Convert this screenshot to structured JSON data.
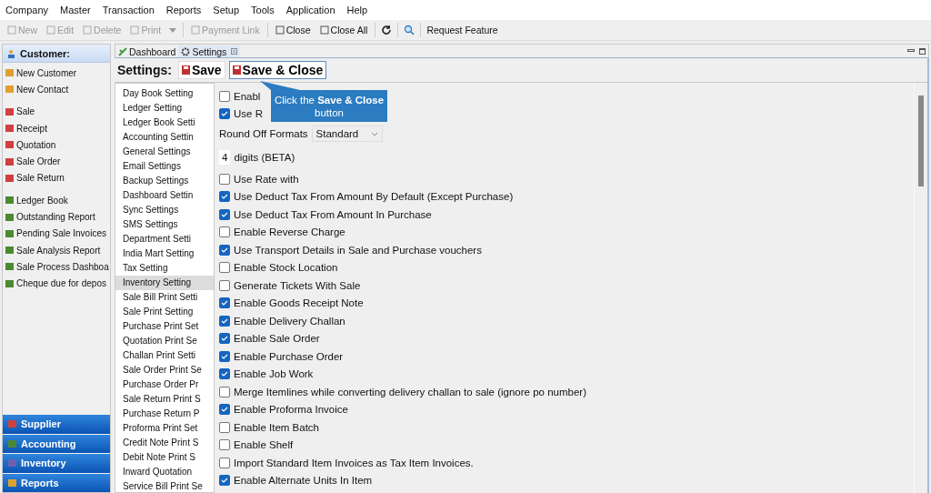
{
  "menu_bar": [
    "Company",
    "Master",
    "Transaction",
    "Reports",
    "Setup",
    "Tools",
    "Application",
    "Help"
  ],
  "toolbar": [
    {
      "label": "New",
      "kind": "button",
      "disabled": true
    },
    {
      "label": "Edit",
      "kind": "button",
      "disabled": true
    },
    {
      "label": "Delete",
      "kind": "button",
      "disabled": true
    },
    {
      "label": "Print",
      "kind": "button",
      "disabled": true
    },
    {
      "kind": "caret",
      "disabled": true
    },
    {
      "label": "Payment Link",
      "kind": "button",
      "disabled": true
    },
    {
      "label": "Close",
      "kind": "button",
      "disabled": false
    },
    {
      "label": "Close All",
      "kind": "button",
      "disabled": false
    },
    {
      "kind": "refresh",
      "disabled": false
    },
    {
      "kind": "search",
      "disabled": false
    },
    {
      "label": "Request Feature",
      "kind": "text",
      "disabled": false
    }
  ],
  "sidebar": {
    "header": "Customer:",
    "groups": [
      [
        "New Customer",
        "New Contact"
      ],
      [
        "Sale",
        "Receipt",
        "Quotation",
        "Sale Order",
        "Sale Return"
      ],
      [
        "Ledger Book",
        "Outstanding Report",
        "Pending Sale Invoices",
        "Sale Analysis Report",
        "Sale Process Dashboa",
        "Cheque due for depos"
      ]
    ],
    "sections": [
      "Supplier",
      "Accounting",
      "Inventory",
      "Reports"
    ]
  },
  "tabs": [
    {
      "label": "Dashboard",
      "selected": false
    },
    {
      "label": "Settings",
      "selected": true
    }
  ],
  "settings": {
    "title": "Settings:",
    "buttons": [
      "Save",
      "Save & Close"
    ],
    "categories": [
      {
        "label": "Day Book Setting",
        "selected": false
      },
      {
        "label": "Ledger Setting",
        "selected": false
      },
      {
        "label": "Ledger Book Setti",
        "selected": false
      },
      {
        "label": "Accounting Settin",
        "selected": false
      },
      {
        "label": "General Settings",
        "selected": false
      },
      {
        "label": "Email Settings",
        "selected": false
      },
      {
        "label": "Backup Settings",
        "selected": false
      },
      {
        "label": "Dashboard Settin",
        "selected": false
      },
      {
        "label": "Sync Settings",
        "selected": false
      },
      {
        "label": "SMS Settings",
        "selected": false
      },
      {
        "label": "Department Setti",
        "selected": false
      },
      {
        "label": "India Mart Setting",
        "selected": false
      },
      {
        "label": "Tax Setting",
        "selected": false
      },
      {
        "label": "Inventory Setting",
        "selected": true
      },
      {
        "label": "Sale Bill Print Setti",
        "selected": false
      },
      {
        "label": "Sale Print Setting",
        "selected": false
      },
      {
        "label": "Purchase Print Set",
        "selected": false
      },
      {
        "label": "Quotation Print Se",
        "selected": false
      },
      {
        "label": "Challan Print Setti",
        "selected": false
      },
      {
        "label": "Sale Order Print Se",
        "selected": false
      },
      {
        "label": "Purchase Order Pr",
        "selected": false
      },
      {
        "label": "Sale Return Print S",
        "selected": false
      },
      {
        "label": "Purchase Return P",
        "selected": false
      },
      {
        "label": "Proforma Print Set",
        "selected": false
      },
      {
        "label": "Credit Note Print S",
        "selected": false
      },
      {
        "label": "Debit Note Print S",
        "selected": false
      },
      {
        "label": "Inward Quotation",
        "selected": false
      },
      {
        "label": "Service Bill Print Se",
        "selected": false
      }
    ],
    "options": [
      {
        "kind": "checkbox",
        "label": "Enabl",
        "checked": false
      },
      {
        "kind": "checkbox",
        "label": "Use R",
        "checked": true
      },
      {
        "kind": "select",
        "label": "Round Off Formats",
        "value": "Standard"
      },
      {
        "kind": "number",
        "label": "digits (BETA)",
        "value": "4"
      },
      {
        "kind": "checkbox",
        "label": "Use Rate with",
        "checked": false
      },
      {
        "kind": "checkbox",
        "label": "Use Deduct Tax From Amount By Default (Except Purchase)",
        "checked": true
      },
      {
        "kind": "checkbox",
        "label": "Use Deduct Tax From Amount In Purchase",
        "checked": true
      },
      {
        "kind": "checkbox",
        "label": "Enable Reverse Charge",
        "checked": false
      },
      {
        "kind": "checkbox",
        "label": "Use Transport Details in Sale and Purchase vouchers",
        "checked": true
      },
      {
        "kind": "checkbox",
        "label": "Enable Stock Location",
        "checked": false
      },
      {
        "kind": "checkbox",
        "label": "Generate Tickets With Sale",
        "checked": false
      },
      {
        "kind": "checkbox",
        "label": "Enable Goods Receipt Note",
        "checked": true
      },
      {
        "kind": "checkbox",
        "label": "Enable Delivery Challan",
        "checked": true
      },
      {
        "kind": "checkbox",
        "label": "Enable Sale Order",
        "checked": true
      },
      {
        "kind": "checkbox",
        "label": "Enable Purchase Order",
        "checked": true
      },
      {
        "kind": "checkbox",
        "label": "Enable Job Work",
        "checked": true
      },
      {
        "kind": "checkbox",
        "label": "Merge Itemlines while converting delivery challan to sale (ignore po number)",
        "checked": false
      },
      {
        "kind": "checkbox",
        "label": "Enable Proforma Invoice",
        "checked": true
      },
      {
        "kind": "checkbox",
        "label": "Enable Item Batch",
        "checked": false
      },
      {
        "kind": "checkbox",
        "label": "Enable Shelf",
        "checked": false
      },
      {
        "kind": "checkbox",
        "label": "Import Standard Item Invoices as Tax Item Invoices.",
        "checked": false
      },
      {
        "kind": "checkbox",
        "label": "Enable Alternate Units In Item",
        "checked": true
      }
    ]
  },
  "callout": {
    "text": "Click the **Save & Close** button"
  }
}
